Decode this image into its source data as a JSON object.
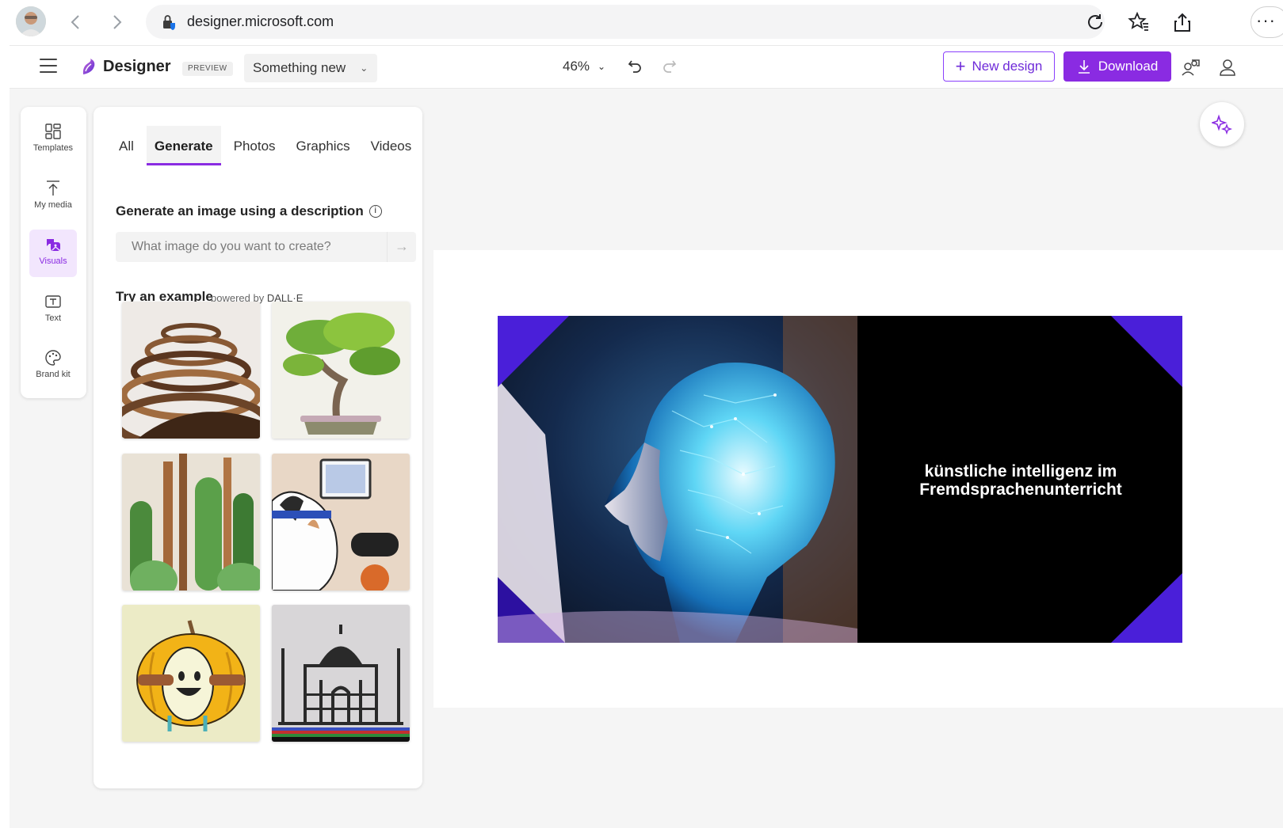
{
  "browser": {
    "url": "designer.microsoft.com",
    "more_label": "···"
  },
  "app": {
    "name": "Designer",
    "badge": "PREVIEW",
    "doc_title": "Something new",
    "zoom": "46%",
    "new_design_label": "New design",
    "download_label": "Download",
    "accent_color": "#8a2be2"
  },
  "rail": {
    "items": [
      {
        "label": "Templates",
        "icon": "templates-icon"
      },
      {
        "label": "My media",
        "icon": "upload-icon"
      },
      {
        "label": "Visuals",
        "icon": "visuals-icon",
        "active": true
      },
      {
        "label": "Text",
        "icon": "text-icon"
      },
      {
        "label": "Brand kit",
        "icon": "palette-icon"
      }
    ]
  },
  "panel": {
    "tabs": [
      {
        "label": "All"
      },
      {
        "label": "Generate",
        "active": true
      },
      {
        "label": "Photos"
      },
      {
        "label": "Graphics"
      },
      {
        "label": "Videos"
      }
    ],
    "section_title": "Generate an image using a description",
    "prompt_placeholder": "What image do you want to create?",
    "example_title": "Try an example",
    "powered_by_prefix": "powered by",
    "powered_by_brand": "DALL·E",
    "examples": [
      {
        "name": "wooden-spiral-sculpture"
      },
      {
        "name": "bonsai-tree-watercolor"
      },
      {
        "name": "cactus-painting"
      },
      {
        "name": "cat-gaming"
      },
      {
        "name": "pumpkin-character"
      },
      {
        "name": "taj-mahal-beads"
      }
    ]
  },
  "slide": {
    "line1": "künstliche intelligenz im",
    "line2": "Fremdsprachenunterricht"
  }
}
